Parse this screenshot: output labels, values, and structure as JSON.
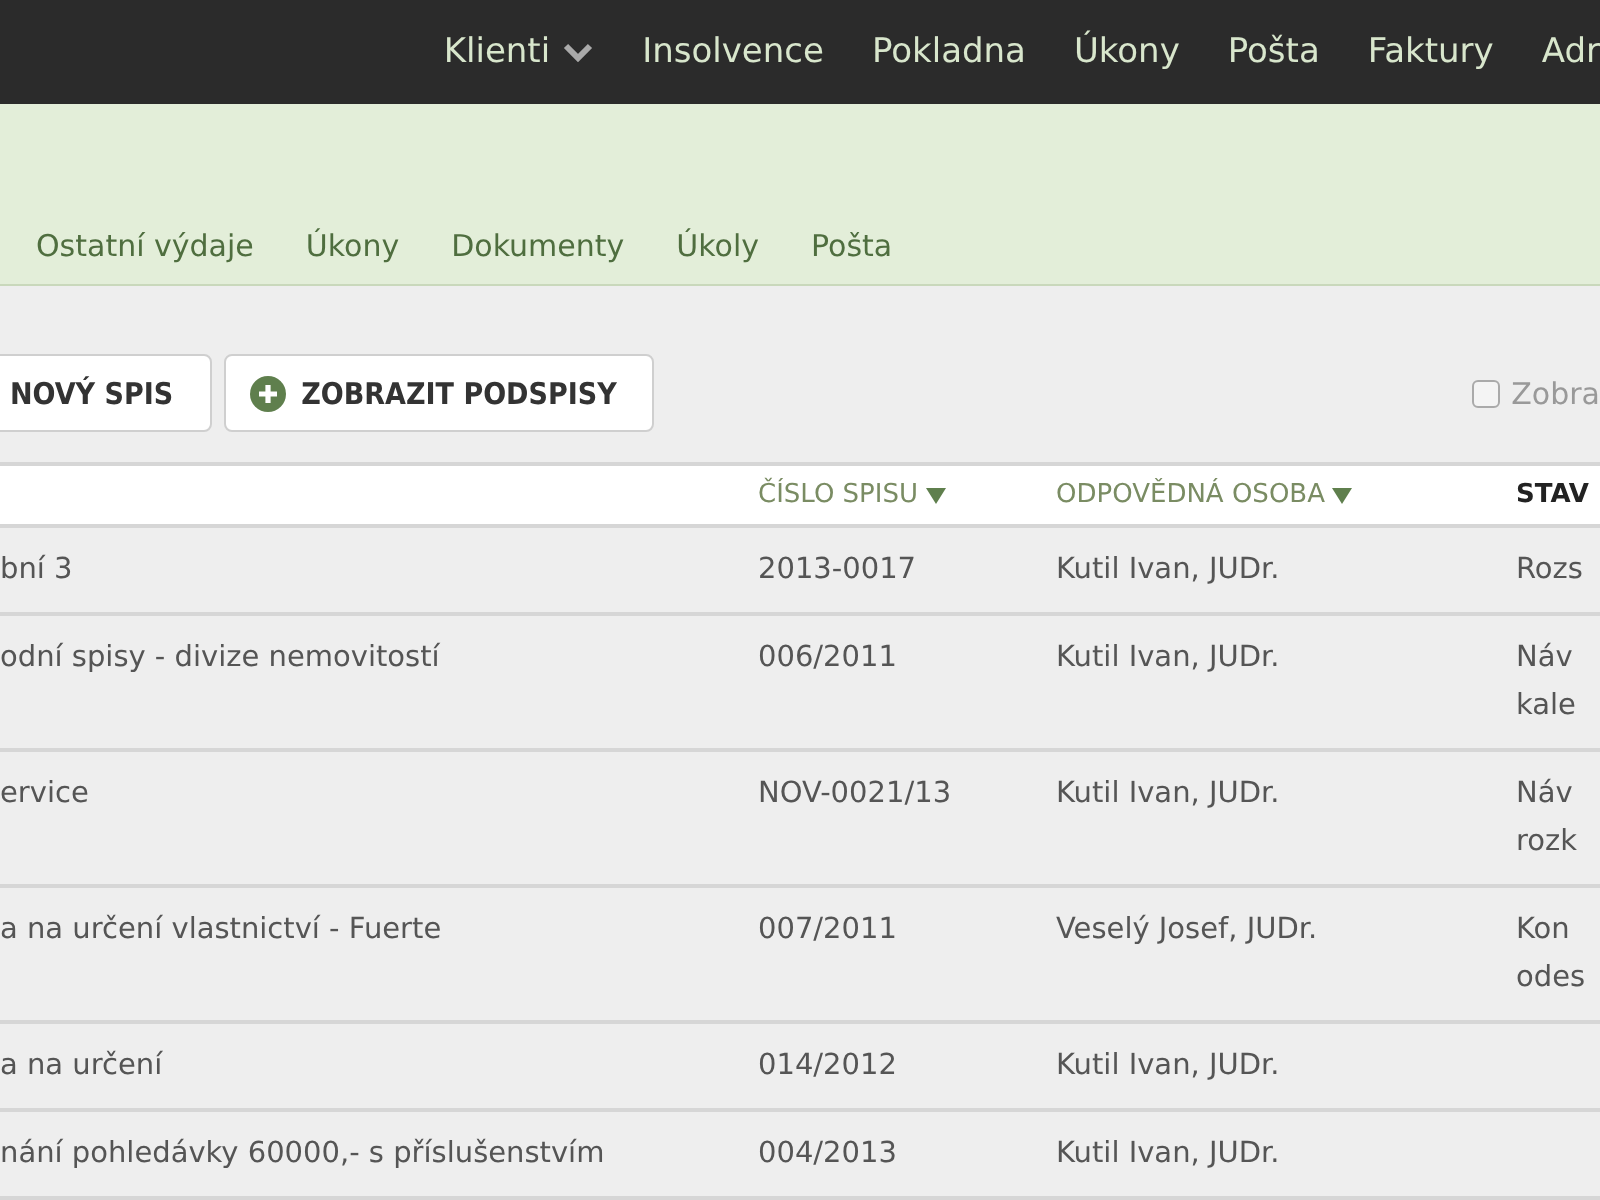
{
  "top_nav": [
    {
      "label": "Klienti",
      "has_menu": true
    },
    {
      "label": "Insolvence",
      "has_menu": false
    },
    {
      "label": "Pokladna",
      "has_menu": false
    },
    {
      "label": "Úkony",
      "has_menu": false
    },
    {
      "label": "Pošta",
      "has_menu": false
    },
    {
      "label": "Faktury",
      "has_menu": false
    },
    {
      "label": "Adr",
      "has_menu": false
    }
  ],
  "tabs": [
    {
      "label": "Ostatní výdaje",
      "selected": false
    },
    {
      "label": "Úkony",
      "selected": false
    },
    {
      "label": "Dokumenty",
      "selected": false
    },
    {
      "label": "Úkoly",
      "selected": false
    },
    {
      "label": "Pošta",
      "selected": false
    }
  ],
  "toolbar": {
    "buttons": [
      {
        "label": "NOVÝ SPIS",
        "kind": "plain"
      },
      {
        "label": "ZOBRAZIT PODSPISY",
        "kind": "add"
      }
    ],
    "checkbox": {
      "label": "Zobra",
      "checked": false
    }
  },
  "table": {
    "columns": [
      {
        "label": "ČÍSLO SPISU",
        "sortable": true
      },
      {
        "label": "ODPOVĚDNÁ OSOBA",
        "sortable": true
      },
      {
        "label": "STAV",
        "sortable": false
      }
    ],
    "rows": [
      {
        "name": "bní 3",
        "number": "2013-0017",
        "person": "Kutil Ivan, JUDr.",
        "status": [
          "Rozs"
        ]
      },
      {
        "name": "odní spisy - divize nemovitostí",
        "number": "006/2011",
        "person": "Kutil Ivan, JUDr.",
        "status": [
          "Náv",
          "kale"
        ]
      },
      {
        "name": "ervice",
        "number": "NOV-0021/13",
        "person": "Kutil Ivan, JUDr.",
        "status": [
          "Náv",
          "rozk"
        ]
      },
      {
        "name": "a na určení vlastnictví - Fuerte",
        "number": "007/2011",
        "person": "Veselý Josef, JUDr.",
        "status": [
          "Kon",
          "odes"
        ]
      },
      {
        "name": "a na určení",
        "number": "014/2012",
        "person": "Kutil Ivan, JUDr.",
        "status": []
      },
      {
        "name": "nání pohledávky 60000,- s příslušenstvím",
        "number": "004/2013",
        "person": "Kutil Ivan, JUDr.",
        "status": []
      }
    ]
  }
}
